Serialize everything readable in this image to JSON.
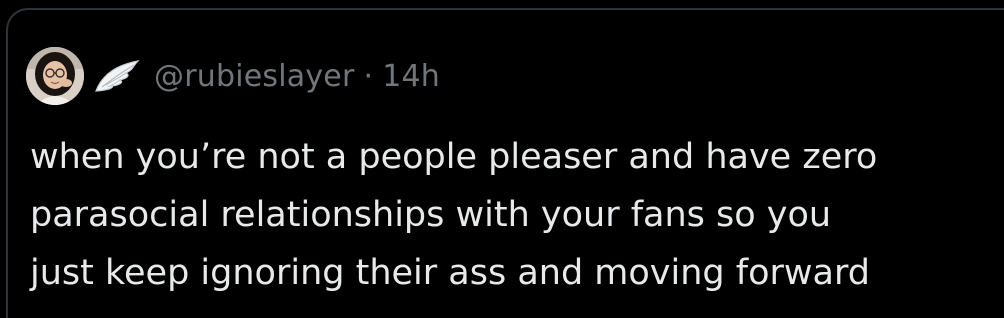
{
  "tweet": {
    "handle": "@rubieslayer",
    "separator": "·",
    "time": "14h",
    "avatar_icon": "profile-photo",
    "badge_icon": "angel-wing-emoji",
    "lines": [
      "when you’re not a people pleaser and have zero",
      "parasocial relationships with your fans so you",
      "just keep ignoring their ass and moving forward"
    ]
  },
  "colors": {
    "background": "#000000",
    "border": "#2f3336",
    "text_primary": "#e7e9ea",
    "text_secondary": "#71767b"
  }
}
